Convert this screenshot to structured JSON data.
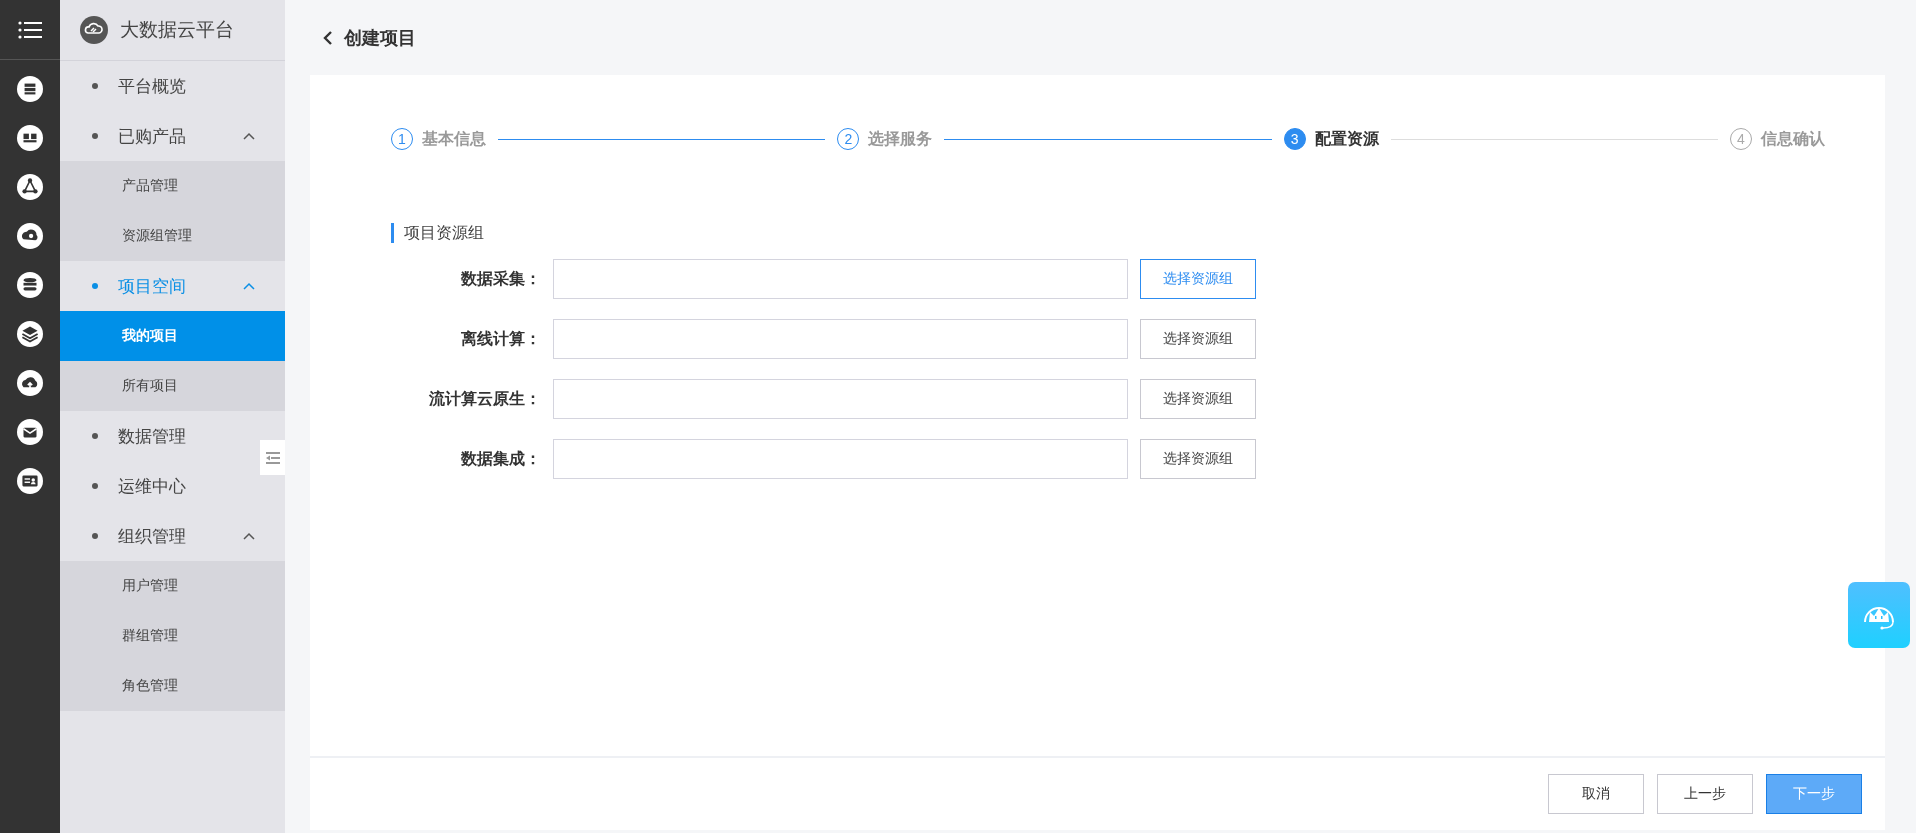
{
  "sidebar": {
    "title": "大数据云平台",
    "items": [
      {
        "label": "平台概览",
        "selected": false
      },
      {
        "label": "已购产品",
        "selected": false,
        "expanded": true,
        "children": [
          {
            "label": "产品管理",
            "selected": false
          },
          {
            "label": "资源组管理",
            "selected": false
          }
        ]
      },
      {
        "label": "项目空间",
        "selected": true,
        "expanded": true,
        "children": [
          {
            "label": "我的项目",
            "selected": true
          },
          {
            "label": "所有项目",
            "selected": false
          }
        ]
      },
      {
        "label": "数据管理",
        "selected": false
      },
      {
        "label": "运维中心",
        "selected": false
      },
      {
        "label": "组织管理",
        "selected": false,
        "expanded": true,
        "children": [
          {
            "label": "用户管理",
            "selected": false
          },
          {
            "label": "群组管理",
            "selected": false
          },
          {
            "label": "角色管理",
            "selected": false
          }
        ]
      }
    ]
  },
  "header": {
    "title": "创建项目"
  },
  "steps": [
    {
      "number": "1",
      "label": "基本信息",
      "completed": true,
      "current": false
    },
    {
      "number": "2",
      "label": "选择服务",
      "completed": true,
      "current": false
    },
    {
      "number": "3",
      "label": "配置资源",
      "completed": false,
      "current": true
    },
    {
      "number": "4",
      "label": "信息确认",
      "completed": false,
      "current": false
    }
  ],
  "section": {
    "title": "项目资源组",
    "fields": [
      {
        "label": "数据采集：",
        "button": "选择资源组",
        "active": true
      },
      {
        "label": "离线计算：",
        "button": "选择资源组",
        "active": false
      },
      {
        "label": "流计算云原生：",
        "button": "选择资源组",
        "active": false
      },
      {
        "label": "数据集成：",
        "button": "选择资源组",
        "active": false
      }
    ]
  },
  "footer_buttons": [
    {
      "label": "取消",
      "kind": "default"
    },
    {
      "label": "上一步",
      "kind": "default"
    },
    {
      "label": "下一步",
      "kind": "primary"
    }
  ]
}
